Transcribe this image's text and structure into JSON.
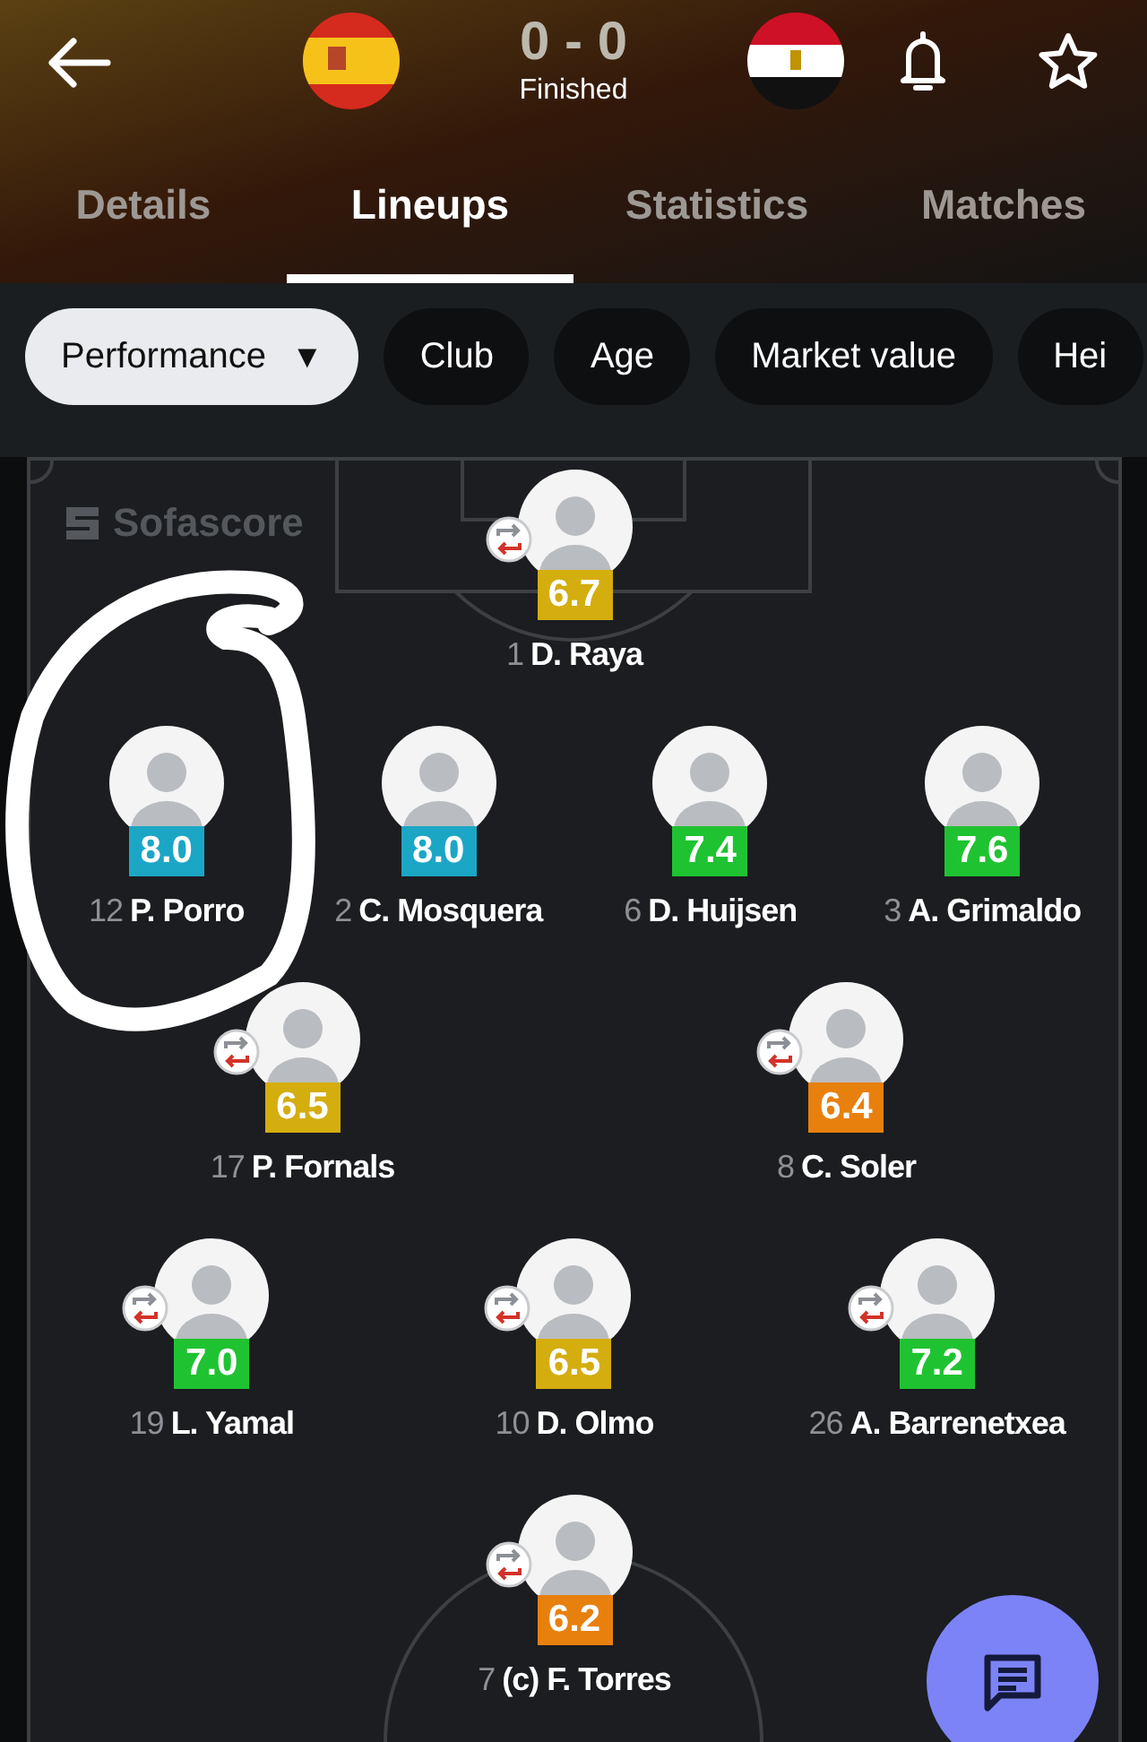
{
  "match": {
    "score": "0 - 0",
    "status": "Finished"
  },
  "tabs": [
    {
      "label": "Details",
      "selected": false
    },
    {
      "label": "Lineups",
      "selected": true
    },
    {
      "label": "Statistics",
      "selected": false
    },
    {
      "label": "Matches",
      "selected": false
    }
  ],
  "filters": [
    {
      "label": "Performance",
      "selected": true,
      "caret": "▼"
    },
    {
      "label": "Club",
      "selected": false
    },
    {
      "label": "Age",
      "selected": false
    },
    {
      "label": "Market value",
      "selected": false
    },
    {
      "label": "Hei",
      "selected": false
    }
  ],
  "pitch": {
    "watermark": "Sofascore",
    "rows": [
      {
        "players": [
          {
            "number": "1",
            "name": "D. Raya",
            "rating": "6.7",
            "color": "#d4ad0e",
            "substituted": true
          }
        ]
      },
      {
        "players": [
          {
            "number": "12",
            "name": "P. Porro",
            "rating": "8.0",
            "color": "#1ca6c6",
            "substituted": false
          },
          {
            "number": "2",
            "name": "C. Mosquera",
            "rating": "8.0",
            "color": "#1ca6c6",
            "substituted": false
          },
          {
            "number": "6",
            "name": "D. Huijsen",
            "rating": "7.4",
            "color": "#1fc331",
            "substituted": false
          },
          {
            "number": "3",
            "name": "A. Grimaldo",
            "rating": "7.6",
            "color": "#1fc331",
            "substituted": false
          }
        ]
      },
      {
        "players": [
          {
            "number": "17",
            "name": "P. Fornals",
            "rating": "6.5",
            "color": "#d4ad0e",
            "substituted": true
          },
          {
            "number": "8",
            "name": "C. Soler",
            "rating": "6.4",
            "color": "#e8800e",
            "substituted": true
          }
        ]
      },
      {
        "players": [
          {
            "number": "19",
            "name": "L. Yamal",
            "rating": "7.0",
            "color": "#1fc331",
            "substituted": true
          },
          {
            "number": "10",
            "name": "D. Olmo",
            "rating": "6.5",
            "color": "#d4ad0e",
            "substituted": true
          },
          {
            "number": "26",
            "name": "A. Barrenetxea",
            "rating": "7.2",
            "color": "#1fc331",
            "substituted": true
          }
        ]
      },
      {
        "players": [
          {
            "number": "7",
            "name": "(c) F. Torres",
            "rating": "6.2",
            "color": "#e8800e",
            "substituted": true
          }
        ]
      }
    ]
  }
}
